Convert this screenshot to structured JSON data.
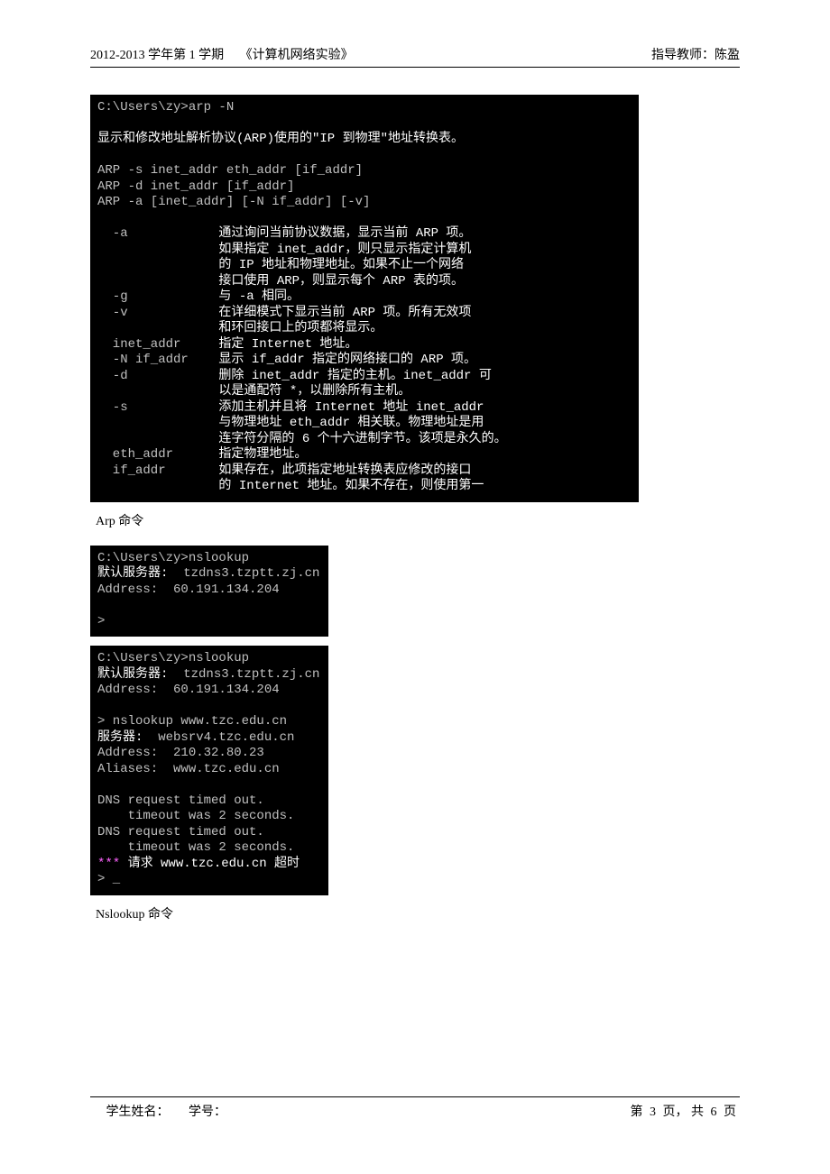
{
  "header": {
    "year_link": "2012-2013",
    "year_suffix": " 学年第",
    "semester_num": " 1 ",
    "semester_suffix": "学期",
    "course": "《计算机网络实验》",
    "teacher_label": "指导教师：",
    "teacher_name": "陈盈"
  },
  "terminal1": {
    "prompt": "C:\\Users\\zy>arp -N",
    "blank1": "",
    "desc": "显示和修改地址解析协议(ARP)使用的\"IP 到物理\"地址转换表。",
    "blank2": "",
    "syntax1": "ARP -s inet_addr eth_addr [if_addr]",
    "syntax2": "ARP -d inet_addr [if_addr]",
    "syntax3": "ARP -a [inet_addr] [-N if_addr] [-v]",
    "blank3": "",
    "opt_a_k": "  -a            ",
    "opt_a_v1": "通过询问当前协议数据，显示当前 ARP 项。",
    "opt_a_v2": "                如果指定 inet_addr，则只显示指定计算机",
    "opt_a_v3": "                的 IP 地址和物理地址。如果不止一个网络",
    "opt_a_v4": "                接口使用 ARP，则显示每个 ARP 表的项。",
    "opt_g_k": "  -g            ",
    "opt_g_v": "与 -a 相同。",
    "opt_v_k": "  -v            ",
    "opt_v_v1": "在详细模式下显示当前 ARP 项。所有无效项",
    "opt_v_v2": "                和环回接口上的项都将显示。",
    "opt_i_k": "  inet_addr     ",
    "opt_i_v": "指定 Internet 地址。",
    "opt_n_k": "  -N if_addr    ",
    "opt_n_v": "显示 if_addr 指定的网络接口的 ARP 项。",
    "opt_d_k": "  -d            ",
    "opt_d_v1": "删除 inet_addr 指定的主机。inet_addr 可",
    "opt_d_v2": "                以是通配符 *，以删除所有主机。",
    "opt_s_k": "  -s            ",
    "opt_s_v1": "添加主机并且将 Internet 地址 inet_addr",
    "opt_s_v2": "                与物理地址 eth_addr 相关联。物理地址是用",
    "opt_s_v3": "                连字符分隔的 6 个十六进制字节。该项是永久的。",
    "opt_e_k": "  eth_addr      ",
    "opt_e_v": "指定物理地址。",
    "opt_f_k": "  if_addr       ",
    "opt_f_v1": "如果存在，此项指定地址转换表应修改的接口",
    "opt_f_v2": "                的 Internet 地址。如果不存在，则使用第一"
  },
  "caption1": "Arp 命令",
  "terminal2": {
    "l1": "C:\\Users\\zy>nslookup",
    "l2a": "默认服务器:  ",
    "l2b": "tzdns3.tzptt.zj.cn",
    "l3": "Address:  60.191.134.204",
    "l4": "",
    "l5": ">"
  },
  "terminal3": {
    "l1": "C:\\Users\\zy>nslookup",
    "l2a": "默认服务器:  ",
    "l2b": "tzdns3.tzptt.zj.cn",
    "l3": "Address:  60.191.134.204",
    "l4": "",
    "l5": "> nslookup www.tzc.edu.cn",
    "l6a": "服务器:  ",
    "l6b": "websrv4.tzc.edu.cn",
    "l7": "Address:  210.32.80.23",
    "l8": "Aliases:  www.tzc.edu.cn",
    "l9": "",
    "l10": "DNS request timed out.",
    "l11": "    timeout was 2 seconds.",
    "l12": "DNS request timed out.",
    "l13": "    timeout was 2 seconds.",
    "l14a": "*** ",
    "l14b": "请求 www.tzc.edu.cn 超时",
    "l15": "> _"
  },
  "caption2": "Nslookup 命令",
  "footer": {
    "name_label": "学生姓名：",
    "id_label": "学号：",
    "page_prefix": "第 ",
    "page_num": "3",
    "page_mid": " 页， 共 ",
    "page_total": "6",
    "page_suffix": "  页"
  }
}
